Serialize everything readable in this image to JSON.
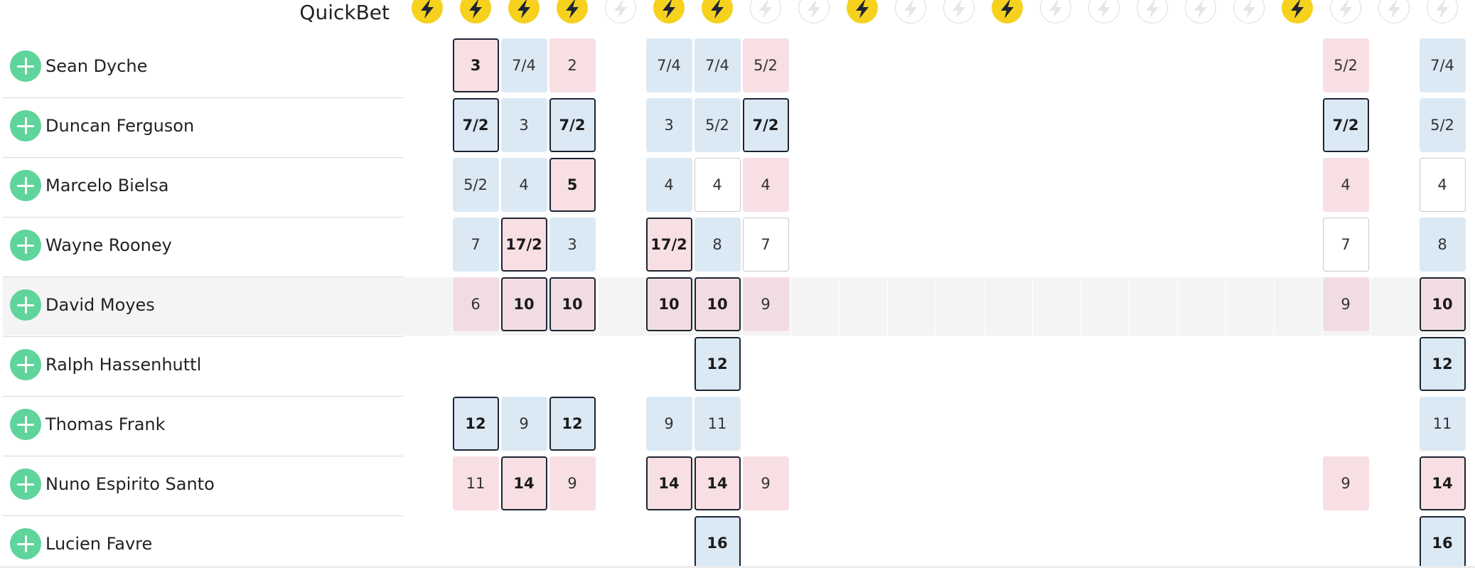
{
  "header": {
    "title": "QuickBet",
    "columns": [
      {
        "icon": "lightning-bolt-icon",
        "active": true
      },
      {
        "icon": "lightning-bolt-icon",
        "active": true
      },
      {
        "icon": "lightning-bolt-icon",
        "active": true
      },
      {
        "icon": "lightning-bolt-icon",
        "active": true
      },
      {
        "icon": "lightning-bolt-icon",
        "active": false
      },
      {
        "icon": "lightning-bolt-icon",
        "active": true
      },
      {
        "icon": "lightning-bolt-icon",
        "active": true
      },
      {
        "icon": "lightning-bolt-icon",
        "active": false
      },
      {
        "icon": "lightning-bolt-icon",
        "active": false
      },
      {
        "icon": "lightning-bolt-icon",
        "active": true
      },
      {
        "icon": "lightning-bolt-icon",
        "active": false
      },
      {
        "icon": "lightning-bolt-icon",
        "active": false
      },
      {
        "icon": "lightning-bolt-icon",
        "active": true
      },
      {
        "icon": "lightning-bolt-icon",
        "active": false
      },
      {
        "icon": "lightning-bolt-icon",
        "active": false
      },
      {
        "icon": "lightning-bolt-icon",
        "active": false
      },
      {
        "icon": "lightning-bolt-icon",
        "active": false
      },
      {
        "icon": "lightning-bolt-icon",
        "active": false
      },
      {
        "icon": "lightning-bolt-icon",
        "active": true
      },
      {
        "icon": "lightning-bolt-icon",
        "active": false
      },
      {
        "icon": "lightning-bolt-icon",
        "active": false
      },
      {
        "icon": "lightning-bolt-icon",
        "active": false
      }
    ]
  },
  "colors": {
    "odds_blue": "#dbe9f5",
    "odds_pink": "#f7dfe4",
    "best_border": "#1e2433",
    "add_green": "#5fd49b",
    "bolt_yellow": "#f6d11e"
  },
  "rows": [
    {
      "name": "Sean Dyche",
      "add_icon": "plus-circle-icon",
      "highlight": false,
      "odds": [
        {
          "col": 1,
          "value": "3",
          "style": "p",
          "best": true
        },
        {
          "col": 2,
          "value": "7/4",
          "style": "b",
          "best": false
        },
        {
          "col": 3,
          "value": "2",
          "style": "p",
          "best": false
        },
        {
          "col": 5,
          "value": "7/4",
          "style": "b",
          "best": false
        },
        {
          "col": 6,
          "value": "7/4",
          "style": "b",
          "best": false
        },
        {
          "col": 7,
          "value": "5/2",
          "style": "p",
          "best": false
        },
        {
          "col": 19,
          "value": "5/2",
          "style": "p",
          "best": false
        },
        {
          "col": 21,
          "value": "7/4",
          "style": "b",
          "best": false
        }
      ]
    },
    {
      "name": "Duncan Ferguson",
      "add_icon": "plus-circle-icon",
      "highlight": false,
      "odds": [
        {
          "col": 1,
          "value": "7/2",
          "style": "b",
          "best": true
        },
        {
          "col": 2,
          "value": "3",
          "style": "b",
          "best": false
        },
        {
          "col": 3,
          "value": "7/2",
          "style": "b",
          "best": true
        },
        {
          "col": 5,
          "value": "3",
          "style": "b",
          "best": false
        },
        {
          "col": 6,
          "value": "5/2",
          "style": "b",
          "best": false
        },
        {
          "col": 7,
          "value": "7/2",
          "style": "b",
          "best": true
        },
        {
          "col": 19,
          "value": "7/2",
          "style": "b",
          "best": true
        },
        {
          "col": 21,
          "value": "5/2",
          "style": "b",
          "best": false
        }
      ]
    },
    {
      "name": "Marcelo Bielsa",
      "add_icon": "plus-circle-icon",
      "highlight": false,
      "odds": [
        {
          "col": 1,
          "value": "5/2",
          "style": "b",
          "best": false
        },
        {
          "col": 2,
          "value": "4",
          "style": "b",
          "best": false
        },
        {
          "col": 3,
          "value": "5",
          "style": "p",
          "best": true
        },
        {
          "col": 5,
          "value": "4",
          "style": "b",
          "best": false
        },
        {
          "col": 6,
          "value": "4",
          "style": "w",
          "best": false
        },
        {
          "col": 7,
          "value": "4",
          "style": "p",
          "best": false
        },
        {
          "col": 19,
          "value": "4",
          "style": "p",
          "best": false
        },
        {
          "col": 21,
          "value": "4",
          "style": "w",
          "best": false
        }
      ]
    },
    {
      "name": "Wayne Rooney",
      "add_icon": "plus-circle-icon",
      "highlight": false,
      "odds": [
        {
          "col": 1,
          "value": "7",
          "style": "b",
          "best": false
        },
        {
          "col": 2,
          "value": "17/2",
          "style": "p",
          "best": true
        },
        {
          "col": 3,
          "value": "3",
          "style": "b",
          "best": false
        },
        {
          "col": 5,
          "value": "17/2",
          "style": "p",
          "best": true
        },
        {
          "col": 6,
          "value": "8",
          "style": "b",
          "best": false
        },
        {
          "col": 7,
          "value": "7",
          "style": "w",
          "best": false
        },
        {
          "col": 19,
          "value": "7",
          "style": "w",
          "best": false
        },
        {
          "col": 21,
          "value": "8",
          "style": "b",
          "best": false
        }
      ]
    },
    {
      "name": "David Moyes",
      "add_icon": "plus-circle-icon",
      "highlight": true,
      "odds": [
        {
          "col": 1,
          "value": "6",
          "style": "p",
          "best": false
        },
        {
          "col": 2,
          "value": "10",
          "style": "p",
          "best": true
        },
        {
          "col": 3,
          "value": "10",
          "style": "p",
          "best": true
        },
        {
          "col": 5,
          "value": "10",
          "style": "p",
          "best": true
        },
        {
          "col": 6,
          "value": "10",
          "style": "p",
          "best": true
        },
        {
          "col": 7,
          "value": "9",
          "style": "p",
          "best": false
        },
        {
          "col": 19,
          "value": "9",
          "style": "p",
          "best": false
        },
        {
          "col": 21,
          "value": "10",
          "style": "p",
          "best": true
        }
      ]
    },
    {
      "name": "Ralph Hassenhuttl",
      "add_icon": "plus-circle-icon",
      "highlight": false,
      "odds": [
        {
          "col": 6,
          "value": "12",
          "style": "b",
          "best": true
        },
        {
          "col": 21,
          "value": "12",
          "style": "b",
          "best": true
        }
      ]
    },
    {
      "name": "Thomas Frank",
      "add_icon": "plus-circle-icon",
      "highlight": false,
      "odds": [
        {
          "col": 1,
          "value": "12",
          "style": "b",
          "best": true
        },
        {
          "col": 2,
          "value": "9",
          "style": "b",
          "best": false
        },
        {
          "col": 3,
          "value": "12",
          "style": "b",
          "best": true
        },
        {
          "col": 5,
          "value": "9",
          "style": "b",
          "best": false
        },
        {
          "col": 6,
          "value": "11",
          "style": "b",
          "best": false
        },
        {
          "col": 21,
          "value": "11",
          "style": "b",
          "best": false
        }
      ]
    },
    {
      "name": "Nuno Espirito Santo",
      "add_icon": "plus-circle-icon",
      "highlight": false,
      "odds": [
        {
          "col": 1,
          "value": "11",
          "style": "p",
          "best": false
        },
        {
          "col": 2,
          "value": "14",
          "style": "p",
          "best": true
        },
        {
          "col": 3,
          "value": "9",
          "style": "p",
          "best": false
        },
        {
          "col": 5,
          "value": "14",
          "style": "p",
          "best": true
        },
        {
          "col": 6,
          "value": "14",
          "style": "p",
          "best": true
        },
        {
          "col": 7,
          "value": "9",
          "style": "p",
          "best": false
        },
        {
          "col": 19,
          "value": "9",
          "style": "p",
          "best": false
        },
        {
          "col": 21,
          "value": "14",
          "style": "p",
          "best": true
        }
      ]
    },
    {
      "name": "Lucien Favre",
      "add_icon": "plus-circle-icon",
      "highlight": false,
      "odds": [
        {
          "col": 6,
          "value": "16",
          "style": "b",
          "best": true
        },
        {
          "col": 21,
          "value": "16",
          "style": "b",
          "best": true
        }
      ]
    }
  ]
}
